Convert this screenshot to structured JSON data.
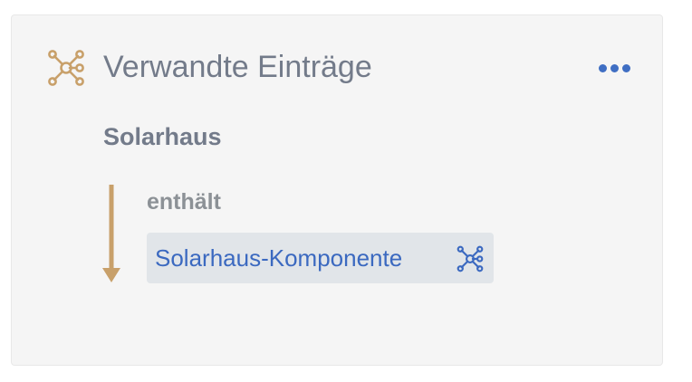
{
  "panel": {
    "header_icon": "network-graph-icon",
    "title": "Verwandte Einträge",
    "more_icon": "more-horizontal-icon"
  },
  "relation": {
    "source": "Solarhaus",
    "type": "enthält",
    "direction_icon": "arrow-down-icon",
    "target": {
      "label": "Solarhaus-Komponente",
      "icon": "network-graph-icon"
    }
  },
  "colors": {
    "accent_gold": "#c8a06a",
    "link_blue": "#3b69c0",
    "title_gray": "#737b8a",
    "chip_bg": "#e1e5e9",
    "panel_bg": "#f5f5f5"
  }
}
